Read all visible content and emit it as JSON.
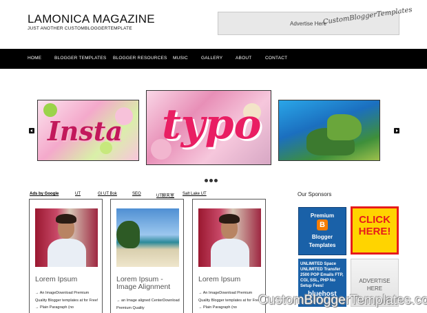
{
  "header": {
    "site_title": "LAMONICA MAGAZINE",
    "site_description": "JUST ANOTHER CUSTOMBLOGGERTEMPLATE",
    "ad_banner": {
      "text": "Advertise Here",
      "brand": "CustomBloggerTemplates"
    }
  },
  "nav": {
    "items": [
      {
        "label": "HOME"
      },
      {
        "label": "BLOGGER TEMPLATES"
      },
      {
        "label": "BLOGGER RESOURCES"
      },
      {
        "label": "MUSIC"
      },
      {
        "label": "GALLERY"
      },
      {
        "label": "ABOUT"
      },
      {
        "label": "CONTACT"
      }
    ]
  },
  "slider": {
    "left_arrow_icon": "chevron-left-icon",
    "right_arrow_icon": "chevron-right-icon",
    "slides": [
      {
        "word": "Insta"
      },
      {
        "word": "typo"
      },
      {
        "word": ""
      }
    ],
    "dot_count": 3
  },
  "ads_row": {
    "items": [
      {
        "label": "Ads by Google"
      },
      {
        "label": "UT"
      },
      {
        "label": "GI UT Bok"
      },
      {
        "label": "SEO"
      },
      {
        "label": "UT聊天室"
      },
      {
        "label": "Salt Lake UT"
      }
    ]
  },
  "posts": [
    {
      "title": "Lorem Ipsum",
      "excerpt": "→ An ImageDownload Premium Quality Blogger templates at for Free! → Plain Paragraph (no"
    },
    {
      "title": "Lorem Ipsum - Image Alignment",
      "excerpt": "→ an Image aligned CenterDownload Premium Quality"
    },
    {
      "title": "Lorem Ipsum",
      "excerpt": "→ An ImageDownload Premium Quality Blogger templates at for Free! → Plain Paragraph (no"
    }
  ],
  "sponsors": {
    "title": "Our Sponsors",
    "items": [
      {
        "top": "Premium",
        "logo": "B",
        "bottom": "Blogger Templates"
      },
      {
        "text": "CLICK HERE!"
      },
      {
        "text": "UNLIMITED Space UNLIMITED Transfer 2500 POP Emails FTP, CGI, SSL, PHP No Setup Fees!",
        "brand": "bluehost"
      },
      {
        "text": "ADVERTISE HERE"
      }
    ]
  },
  "watermark": "CustomBloggerTemplates.com"
}
